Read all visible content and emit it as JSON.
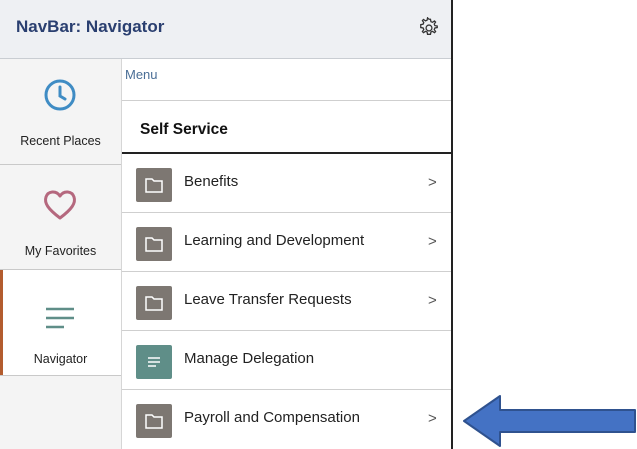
{
  "header": {
    "title": "NavBar: Navigator"
  },
  "sidebar": {
    "items": [
      {
        "label": "Recent Places",
        "icon": "clock-icon"
      },
      {
        "label": "My Favorites",
        "icon": "heart-icon"
      },
      {
        "label": "Navigator",
        "icon": "menu-lines-icon",
        "active": true
      }
    ]
  },
  "menu": {
    "label": "Menu",
    "section_title": "Self Service",
    "items": [
      {
        "label": "Benefits",
        "icon": "folder-icon",
        "chevron": ">"
      },
      {
        "label": "Learning and Development",
        "icon": "folder-icon",
        "chevron": ">"
      },
      {
        "label": "Leave Transfer Requests",
        "icon": "folder-icon",
        "chevron": ">"
      },
      {
        "label": "Manage Delegation",
        "icon": "list-icon",
        "chevron": ""
      },
      {
        "label": "Payroll and Compensation",
        "icon": "folder-icon",
        "chevron": ">"
      }
    ]
  },
  "colors": {
    "header_title": "#2a3f70",
    "active_accent": "#b35c2e",
    "folder_tile": "#7d7772",
    "delegation_tile": "#5f8e88",
    "pointer_arrow": "#4472c4"
  }
}
